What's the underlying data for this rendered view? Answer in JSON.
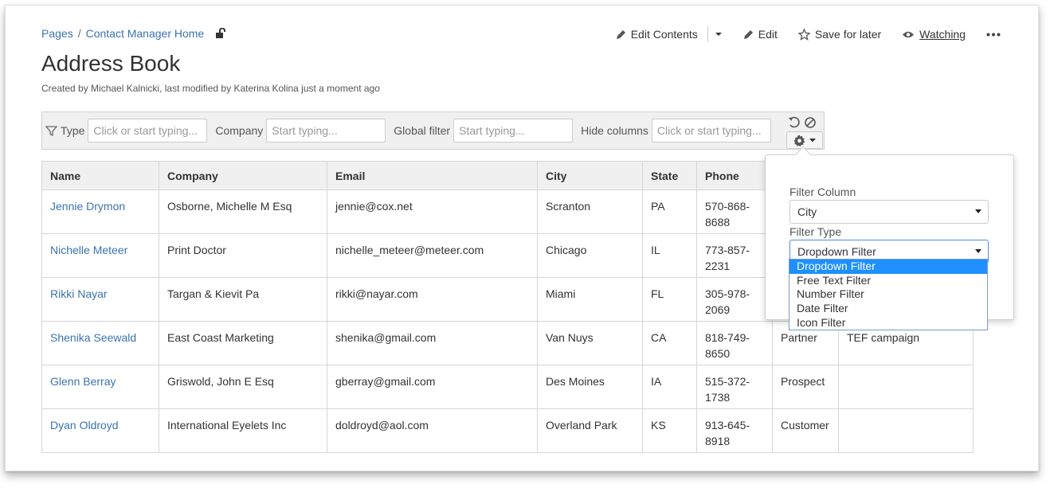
{
  "breadcrumb": {
    "root": "Pages",
    "separator": "/",
    "parent": "Contact Manager Home"
  },
  "page": {
    "title": "Address Book",
    "byline": "Created by Michael Kalnicki, last modified by Katerina Kolina just a moment ago"
  },
  "actions": {
    "edit_contents": "Edit Contents",
    "edit": "Edit",
    "save_for_later": "Save for later",
    "watching": "Watching"
  },
  "filters": {
    "type": {
      "label": "Type",
      "placeholder": "Click or start typing..."
    },
    "company": {
      "label": "Company",
      "placeholder": "Start typing..."
    },
    "global": {
      "label": "Global filter",
      "placeholder": "Start typing..."
    },
    "hide_columns": {
      "label": "Hide columns",
      "placeholder": "Click or start typing..."
    }
  },
  "table": {
    "headers": [
      "Name",
      "Company",
      "Email",
      "City",
      "State",
      "Phone"
    ],
    "rows": [
      {
        "name": "Jennie Drymon",
        "company": "Osborne, Michelle M Esq",
        "email": "jennie@cox.net",
        "city": "Scranton",
        "state": "PA",
        "phone": "570-868-8688",
        "type": "",
        "notes": ""
      },
      {
        "name": "Nichelle Meteer",
        "company": "Print Doctor",
        "email": "nichelle_meteer@meteer.com",
        "city": "Chicago",
        "state": "IL",
        "phone": "773-857-2231",
        "type": "",
        "notes": ""
      },
      {
        "name": "Rikki Nayar",
        "company": "Targan & Kievit Pa",
        "email": "rikki@nayar.com",
        "city": "Miami",
        "state": "FL",
        "phone": "305-978-2069",
        "type": "",
        "notes": ""
      },
      {
        "name": "Shenika Seewald",
        "company": "East Coast Marketing",
        "email": "shenika@gmail.com",
        "city": "Van Nuys",
        "state": "CA",
        "phone": "818-749-8650",
        "type": "Partner",
        "notes": "TEF campaign"
      },
      {
        "name": "Glenn Berray",
        "company": "Griswold, John E Esq",
        "email": "gberray@gmail.com",
        "city": "Des Moines",
        "state": "IA",
        "phone": "515-372-1738",
        "type": "Prospect",
        "notes": ""
      },
      {
        "name": "Dyan Oldroyd",
        "company": "International Eyelets Inc",
        "email": "doldroyd@aol.com",
        "city": "Overland Park",
        "state": "KS",
        "phone": "913-645-8918",
        "type": "Customer",
        "notes": ""
      }
    ]
  },
  "filter_popup": {
    "column_label": "Filter Column",
    "column_value": "City",
    "type_label": "Filter Type",
    "type_value": "Dropdown Filter",
    "options": [
      "Dropdown Filter",
      "Free Text Filter",
      "Number Filter",
      "Date Filter",
      "Icon Filter"
    ],
    "selected_option": "Dropdown Filter"
  },
  "colors": {
    "link": "#3b73af",
    "highlight": "#1e90ff",
    "header_bg": "#f0f0f0"
  }
}
